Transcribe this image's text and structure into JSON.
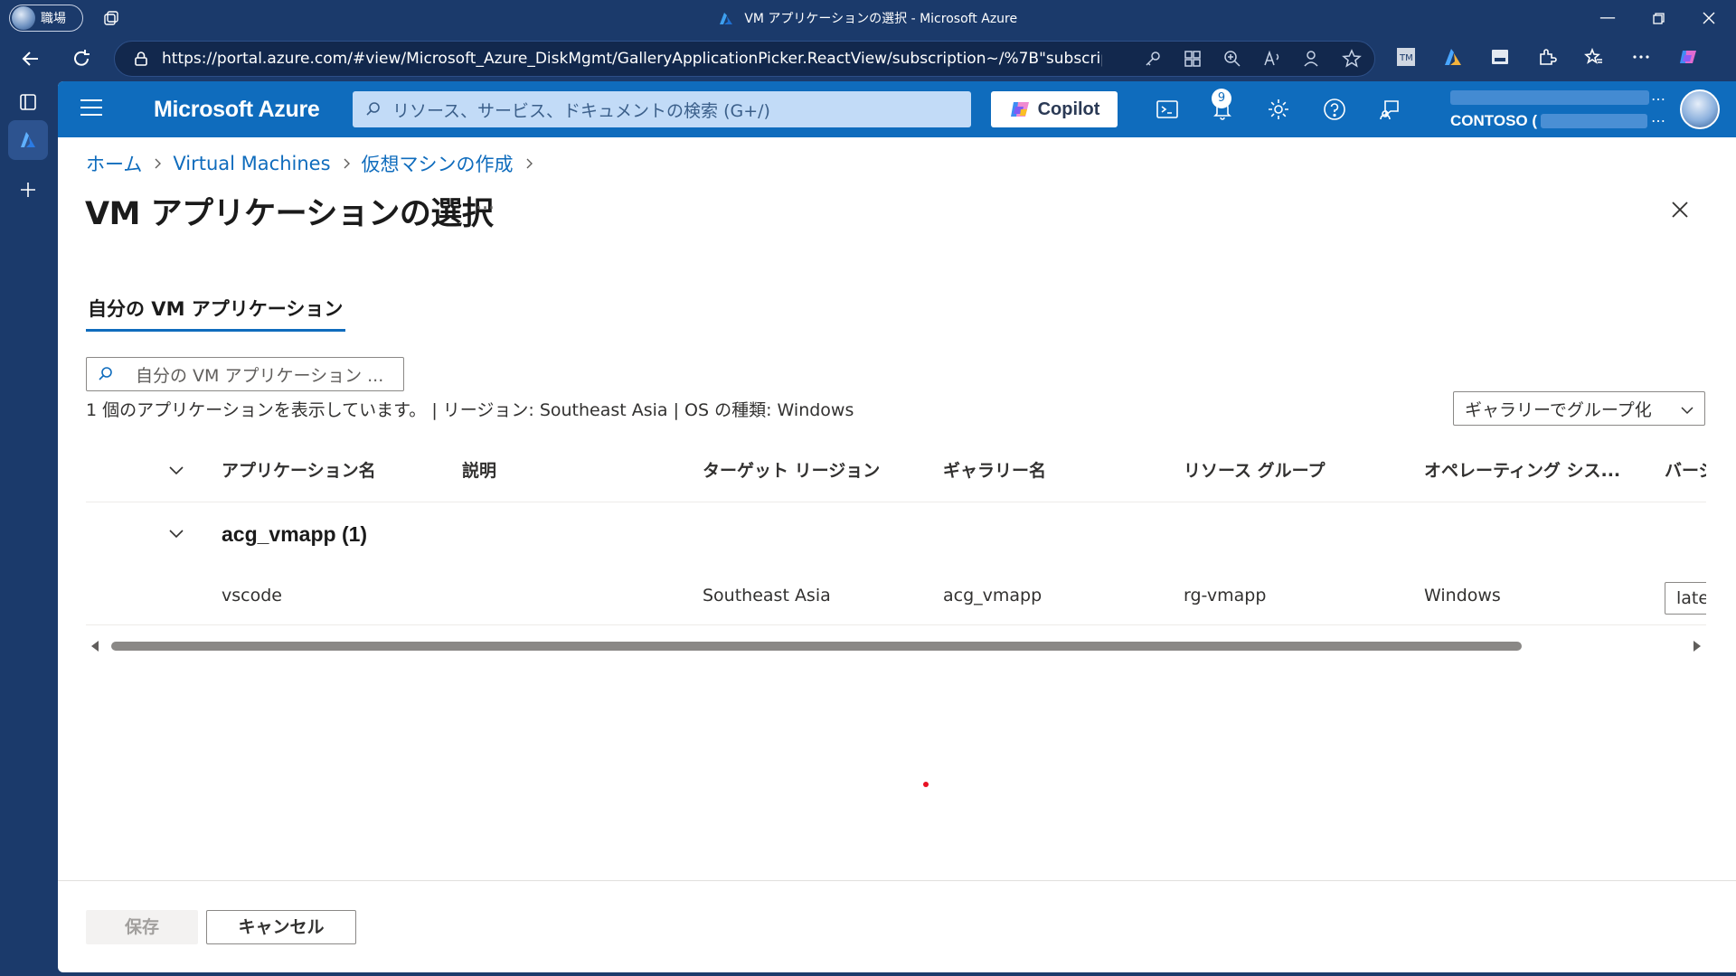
{
  "browser": {
    "profile_label": "職場",
    "window_title": "VM アプリケーションの選択 - Microsoft Azure",
    "url": "https://portal.azure.com/#view/Microsoft_Azure_DiskMgmt/GalleryApplicationPicker.ReactView/subscription~/%7B\"subscriptionId\"..."
  },
  "portal": {
    "brand": "Microsoft Azure",
    "search_placeholder": "リソース、サービス、ドキュメントの検索 (G+/)",
    "copilot_label": "Copilot",
    "notification_count": "9",
    "tenant_label": "CONTOSO (",
    "colors": {
      "topbar": "#0f6cbd",
      "accent": "#0f6cbd",
      "browser_chrome": "#1b3a6b"
    }
  },
  "breadcrumb": [
    "ホーム",
    "Virtual Machines",
    "仮想マシンの作成"
  ],
  "page": {
    "title": "VM アプリケーションの選択",
    "more_label": "...",
    "tab_label": "自分の VM アプリケーション",
    "filter_placeholder": "自分の VM アプリケーション ...",
    "summary": "1 個のアプリケーションを表示しています。 | リージョン: Southeast Asia | OS の種類: Windows",
    "group_by_label": "ギャラリーでグループ化"
  },
  "grid": {
    "columns": [
      "アプリケーション名",
      "説明",
      "ターゲット リージョン",
      "ギャラリー名",
      "リソース グループ",
      "オペレーティング シス...",
      "バージ"
    ],
    "group_label": "acg_vmapp (1)",
    "rows": [
      {
        "name": "vscode",
        "description": "",
        "region": "Southeast Asia",
        "gallery": "acg_vmapp",
        "resource_group": "rg-vmapp",
        "os": "Windows",
        "version": "late"
      }
    ]
  },
  "footer": {
    "save_label": "保存",
    "cancel_label": "キャンセル"
  }
}
